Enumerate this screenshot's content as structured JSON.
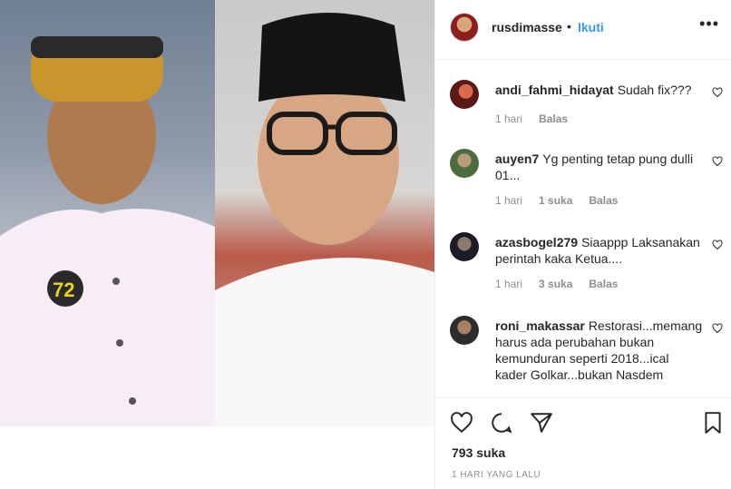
{
  "post": {
    "username": "rusdimasse",
    "follow_label": "Ikuti",
    "separator": "•",
    "more_icon": "•••"
  },
  "comments": [
    {
      "username": "andi_fahmi_hidayat",
      "text": "Sudah fix???",
      "age": "1 hari",
      "likes": "",
      "reply": "Balas"
    },
    {
      "username": "auyen7",
      "text": "Yg penting tetap pung dulli 01...",
      "age": "1 hari",
      "likes": "1 suka",
      "reply": "Balas"
    },
    {
      "username": "azasbogel279",
      "text": "Siaappp Laksanakan perintah kaka Ketua....",
      "age": "1 hari",
      "likes": "3 suka",
      "reply": "Balas"
    },
    {
      "username": "roni_makassar",
      "text": "Restorasi...memang harus ada perubahan bukan kemunduran seperti 2018...ical kader Golkar...bukan Nasdem"
    }
  ],
  "footer": {
    "likes": "793 suka",
    "posted": "1 HARI YANG LALU"
  },
  "colors": {
    "link": "#3897f0",
    "muted": "#8e8e8e",
    "text": "#262626",
    "border": "#efefef"
  }
}
